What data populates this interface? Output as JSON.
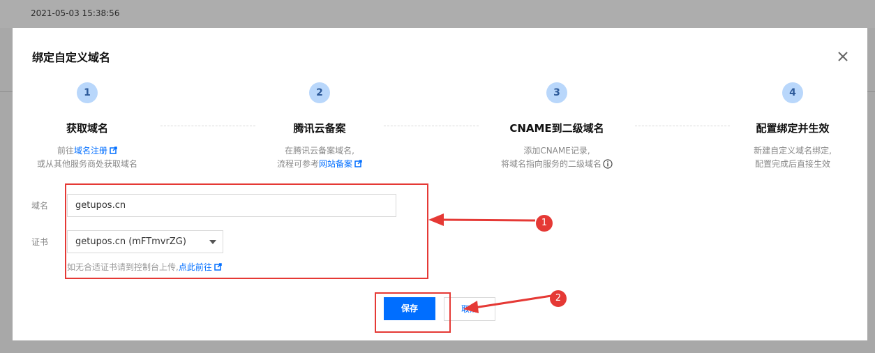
{
  "background": {
    "timestamp": "2021-05-03 15:38:56"
  },
  "modal": {
    "title": "绑定自定义域名",
    "close_icon": "close-icon"
  },
  "steps": [
    {
      "number": "1",
      "title": "获取域名",
      "desc_prefix": "前往",
      "link": "域名注册",
      "desc_line2": "或从其他服务商处获取域名"
    },
    {
      "number": "2",
      "title": "腾讯云备案",
      "desc_line1": "在腾讯云备案域名,",
      "desc_prefix2": "流程可参考",
      "link": "网站备案"
    },
    {
      "number": "3",
      "title": "CNAME到二级域名",
      "desc_line1": "添加CNAME记录,",
      "desc_line2": "将域名指向服务的二级域名"
    },
    {
      "number": "4",
      "title": "配置绑定并生效",
      "desc_line1": "新建自定义域名绑定,",
      "desc_line2": "配置完成后直接生效"
    }
  ],
  "form": {
    "domain_label": "域名",
    "domain_value": "getupos.cn",
    "cert_label": "证书",
    "cert_value": "getupos.cn (mFTmvrZG)",
    "hint_text": "如无合适证书请到控制台上传,",
    "hint_link": "点此前往"
  },
  "buttons": {
    "save": "保存",
    "cancel": "取消"
  },
  "annotations": {
    "marker1": "1",
    "marker2": "2",
    "color": "#e53935"
  },
  "colors": {
    "primary": "#006eff",
    "step_circle": "#b9d7fb"
  }
}
